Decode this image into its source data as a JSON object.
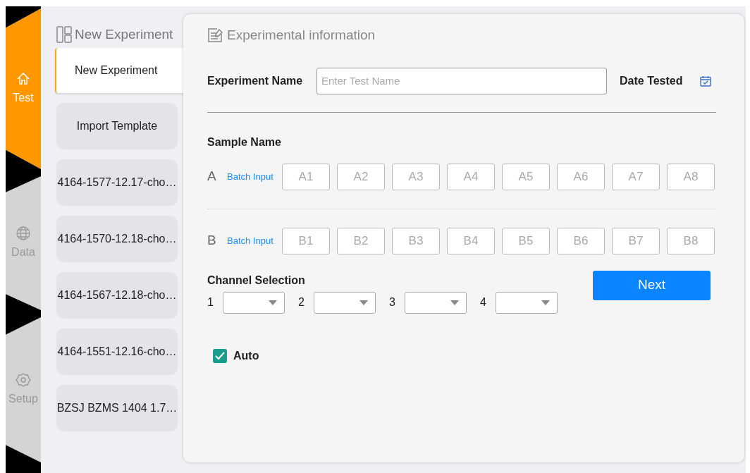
{
  "nav": [
    {
      "label": "Test",
      "selected": true
    },
    {
      "label": "Data",
      "selected": false
    },
    {
      "label": "Setup",
      "selected": false
    }
  ],
  "sidebar": {
    "title": "New Experiment",
    "items": [
      {
        "label": "New Experiment",
        "selected": true
      },
      {
        "label": "Import Template",
        "selected": false
      },
      {
        "label": "4164-1577-12.17-cho…",
        "selected": false
      },
      {
        "label": "4164-1570-12.18-cho…",
        "selected": false
      },
      {
        "label": "4164-1567-12.18-cho…",
        "selected": false
      },
      {
        "label": "4164-1551-12.16-cho…",
        "selected": false
      },
      {
        "label": "BZSJ BZMS 1404 1.7…",
        "selected": false
      }
    ]
  },
  "form": {
    "title": "Experimental information",
    "name_label": "Experiment Name",
    "name_placeholder": "Enter Test Name",
    "date_label": "Date Tested",
    "sample_label": "Sample Name",
    "sample_rows": [
      {
        "label": "A",
        "batch": "Batch Input",
        "cells": [
          "A1",
          "A2",
          "A3",
          "A4",
          "A5",
          "A6",
          "A7",
          "A8"
        ]
      },
      {
        "label": "B",
        "batch": "Batch Input",
        "cells": [
          "B1",
          "B2",
          "B3",
          "B4",
          "B5",
          "B6",
          "B7",
          "B8"
        ]
      }
    ],
    "channel_label": "Channel Selection",
    "channels": [
      "1",
      "2",
      "3",
      "4"
    ],
    "next": "Next",
    "auto": {
      "label": "Auto",
      "checked": true
    }
  }
}
